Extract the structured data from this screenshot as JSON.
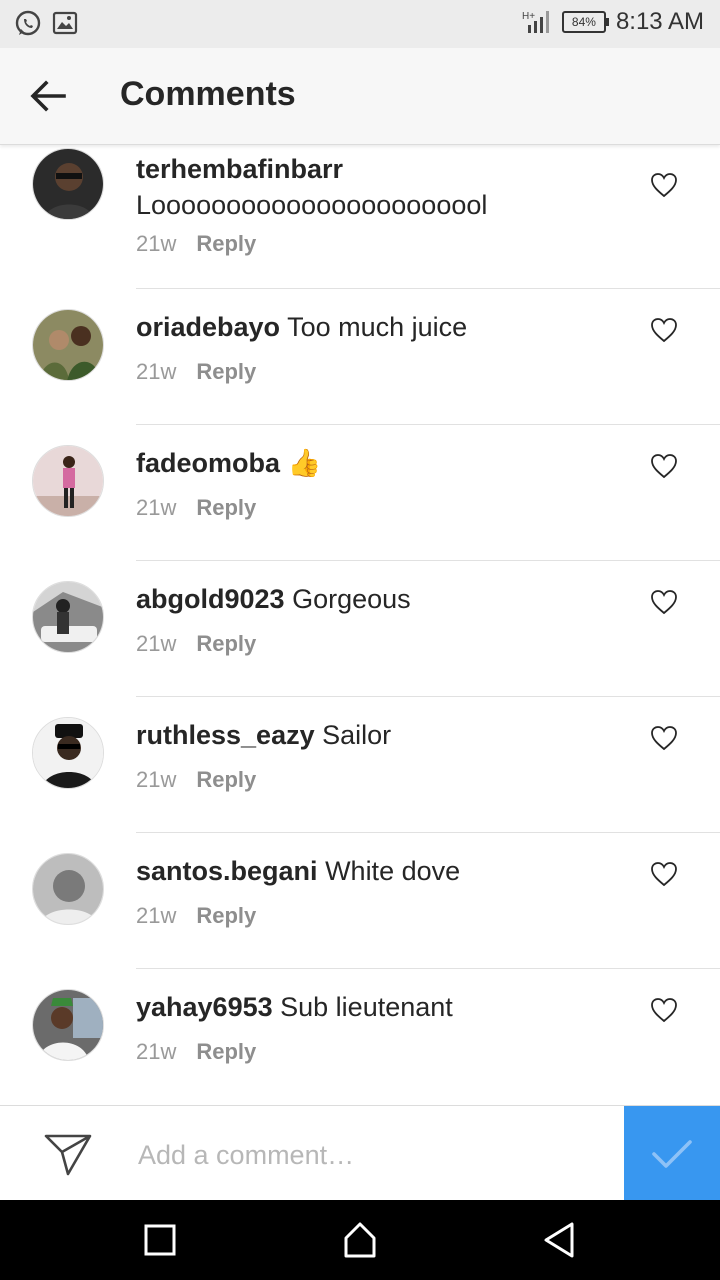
{
  "status_bar": {
    "battery": "84%",
    "time": "8:13 AM",
    "icons": [
      "whatsapp-icon",
      "gallery-icon",
      "signal-icon",
      "battery-icon"
    ]
  },
  "header": {
    "title": "Comments",
    "back_icon": "back-arrow-icon"
  },
  "comments": [
    {
      "username": "terhembafinbarr",
      "text": "Looooooooooooooooooooool",
      "age": "21w",
      "reply": "Reply"
    },
    {
      "username": "oriadebayo",
      "text": "Too much juice",
      "age": "21w",
      "reply": "Reply"
    },
    {
      "username": "fadeomoba",
      "text": "👍",
      "age": "21w",
      "reply": "Reply"
    },
    {
      "username": "abgold9023",
      "text": "Gorgeous",
      "age": "21w",
      "reply": "Reply"
    },
    {
      "username": "ruthless_eazy",
      "text": "Sailor",
      "age": "21w",
      "reply": "Reply"
    },
    {
      "username": "santos.begani",
      "text": "White dove",
      "age": "21w",
      "reply": "Reply"
    },
    {
      "username": "yahay6953",
      "text": "Sub lieutenant",
      "age": "21w",
      "reply": "Reply"
    }
  ],
  "composer": {
    "placeholder": "Add a comment…",
    "send_icon": "direct-send-icon",
    "post_icon": "checkmark-icon"
  },
  "nav_bar": {
    "buttons": [
      "recents-icon",
      "home-icon",
      "back-icon"
    ]
  },
  "colors": {
    "accent": "#3897f0",
    "text": "#262626",
    "muted": "#999999"
  }
}
